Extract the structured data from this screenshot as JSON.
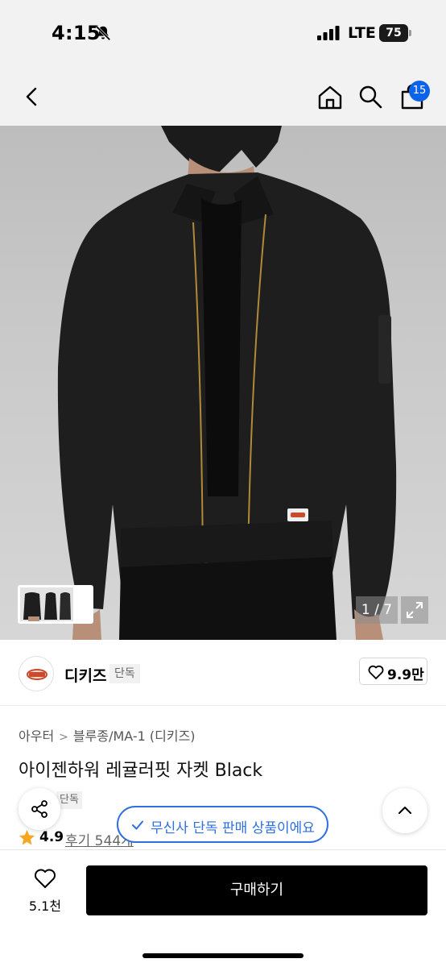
{
  "status_bar": {
    "time": "4:15",
    "network": "LTE",
    "battery": "75"
  },
  "header": {
    "cart_badge": "15"
  },
  "gallery": {
    "counter": "1 / 7"
  },
  "brand": {
    "name": "디키즈",
    "tag": "단독",
    "likes": "9.9만",
    "logo_text": "Dickies"
  },
  "product": {
    "breadcrumb": [
      "아우터",
      "블루종/MA-1 (디키즈)"
    ],
    "title": "아이젠하워 레귤러핏 자켓 Black",
    "exclusive_tag": "단독",
    "rating": "4.9",
    "reviews": "후기 544개",
    "exclusive_notice": "무신사 단독 판매 상품이에요"
  },
  "bottom": {
    "wish_count": "5.1천",
    "buy_label": "구매하기"
  },
  "colors": {
    "accent_blue": "#2f6fe0",
    "badge_blue": "#0a63e8",
    "star": "#f5a623",
    "buy_button": "#000000"
  },
  "icons": [
    "bell-slash-icon",
    "signal-icon",
    "battery-icon",
    "back-icon",
    "home-icon",
    "search-icon",
    "cart-icon",
    "chevron-right-icon",
    "expand-icon",
    "heart-icon",
    "share-icon",
    "star-icon",
    "check-icon",
    "chevron-up-icon"
  ]
}
